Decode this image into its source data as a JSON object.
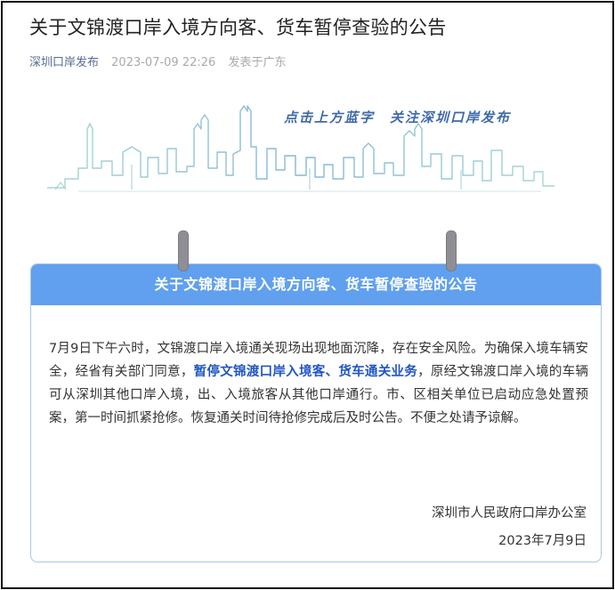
{
  "article": {
    "title": "关于文锦渡口岸入境方向客、货车暂停查验的公告",
    "author": "深圳口岸发布",
    "time": "2023-07-09 22:26",
    "location": "发表于广东"
  },
  "banner": {
    "follow_text": "点击上方蓝字　关注深圳口岸发布"
  },
  "notice": {
    "header": "关于文锦渡口岸入境方向客、货车暂停查验的公告",
    "body_part1": "7月9日下午六时，文锦渡口岸入境通关现场出现地面沉降，存在安全风险。为确保入境车辆安全，经省有关部门同意，",
    "body_highlight": "暂停文锦渡口岸入境客、货车通关业务",
    "body_part2": "，原经文锦渡口岸入境的车辆可从深圳其他口岸入境，出、入境旅客从其他口岸通行。市、区相关单位已启动应急处置预案，第一时间抓紧抢修。恢复通关时间待抢修完成后及时公告。不便之处请予谅解。",
    "signature": "深圳市人民政府口岸办公室",
    "date": "2023年7月9日"
  },
  "colors": {
    "accent_blue": "#60a0ee",
    "author_link": "#576b95",
    "highlight": "#2256c4",
    "skyline_stroke": "#8fc9c8"
  }
}
